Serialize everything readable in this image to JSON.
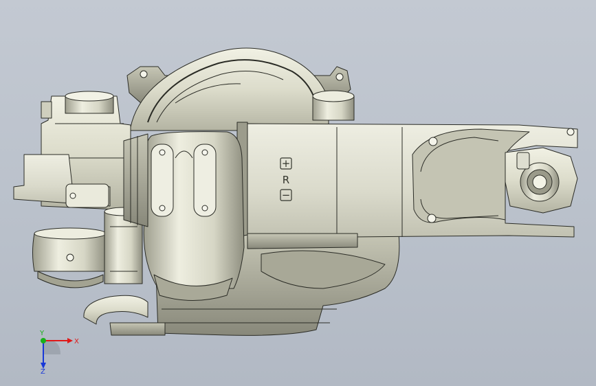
{
  "viewport": {
    "background_top": "#c3c9d2",
    "background_bottom": "#b2b9c4"
  },
  "model": {
    "body_color": "#e2e2d2",
    "shadow_color": "#8e8e7f",
    "edge_color": "#2a2b25",
    "panel_markings": {
      "plus_symbol": "+",
      "mode_letter": "R",
      "minus_symbol": "−"
    }
  },
  "triad": {
    "x_label": "X",
    "y_label": "Y",
    "z_label": "Z",
    "x_color": "#e01818",
    "y_color": "#18b018",
    "z_color": "#1838d8"
  }
}
